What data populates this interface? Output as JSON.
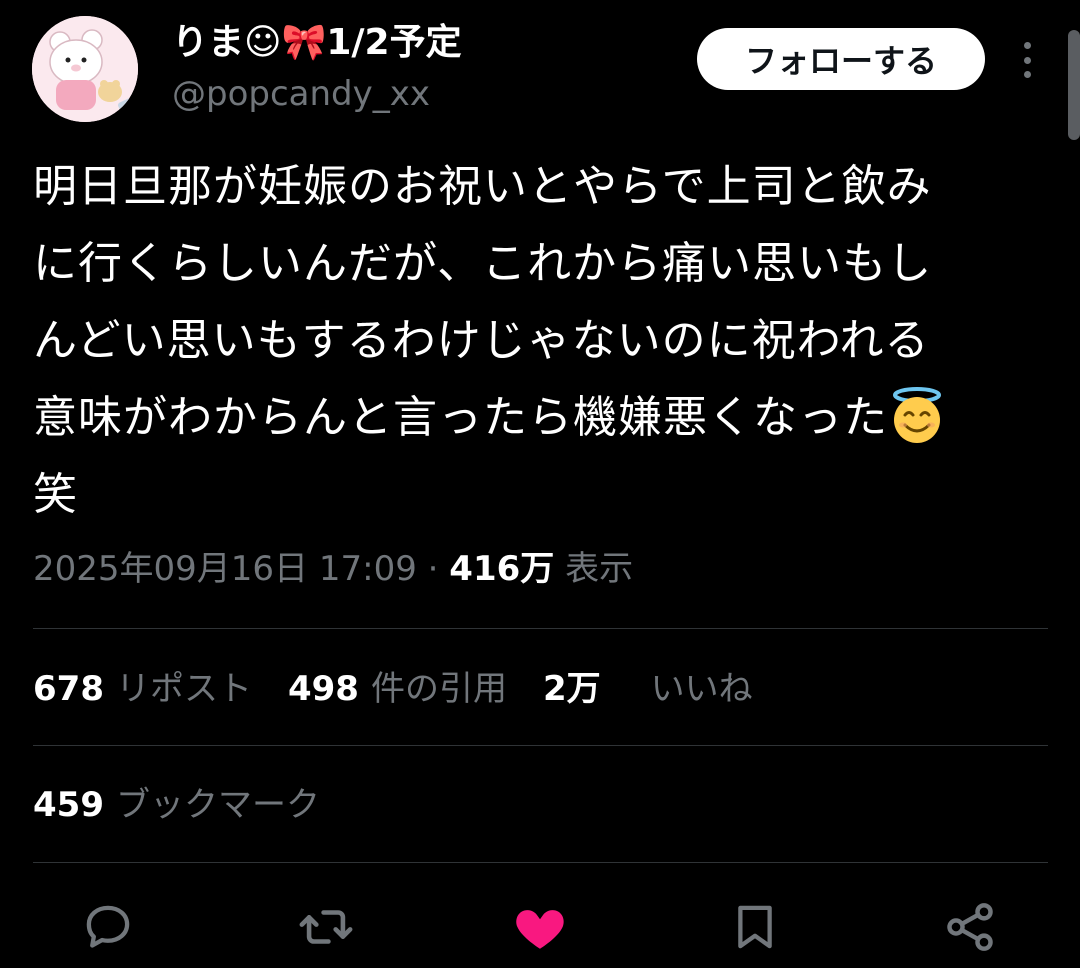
{
  "author": {
    "display_name": "りま☺🎀1/2予定",
    "handle": "@popcandy_xx",
    "avatar_icon": "bear-avatar"
  },
  "follow_button": {
    "label": "フォローする"
  },
  "more_icon": "more-vertical-icon",
  "tweet": {
    "lines": [
      "明日旦那が妊娠のお祝いとやらで上司と飲み",
      "に行くらしいんだが、これから痛い思いもし",
      "んどい思いもするわけじゃないのに祝われる",
      "意味がわからんと言ったら機嫌悪くなった",
      "笑"
    ],
    "emoji": "smiling-face-with-halo"
  },
  "meta": {
    "timestamp": "2025年09月16日 17:09",
    "separator": " · ",
    "views_count": "416万",
    "views_label": " 表示"
  },
  "stats": {
    "reposts": {
      "count": "678",
      "label": "リポスト"
    },
    "quotes": {
      "count": "498",
      "label": "件の引用"
    },
    "likes": {
      "count": "2万",
      "label": "いいね"
    },
    "bookmarks": {
      "count": "459",
      "label": "ブックマーク"
    }
  },
  "colors": {
    "background": "#000000",
    "text": "#ffffff",
    "muted": "#71767b",
    "divider": "#2f3336",
    "like_active": "#f91880"
  },
  "actions": [
    "reply-icon",
    "repost-icon",
    "like-icon",
    "bookmark-icon",
    "share-icon"
  ]
}
